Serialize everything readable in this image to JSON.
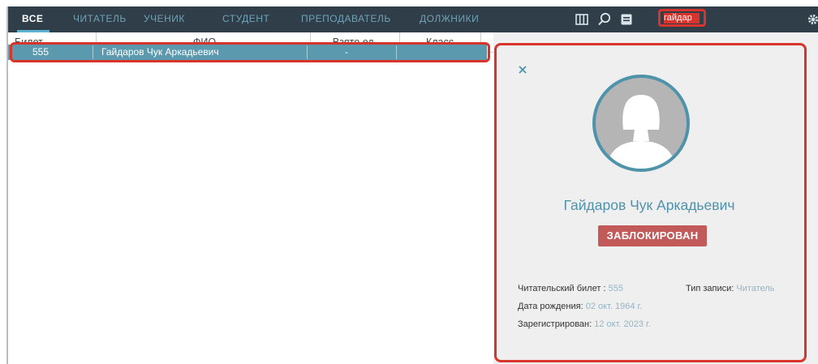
{
  "tabs": [
    {
      "label": "ВСЕ",
      "active": true
    },
    {
      "label": "ЧИТАТЕЛЬ",
      "active": false
    },
    {
      "label": "УЧЕНИК",
      "active": false
    },
    {
      "label": "СТУДЕНТ",
      "active": false
    },
    {
      "label": "ПРЕПОДАВАТЕЛЬ",
      "active": false
    },
    {
      "label": "ДОЛЖНИКИ",
      "active": false
    }
  ],
  "toolbar": {
    "icons": [
      "columns-icon",
      "search-icon",
      "filter-icon"
    ],
    "search_value": "гайдар",
    "settings_icon": "gear-icon"
  },
  "table": {
    "headers": [
      "Билет",
      "ФИО",
      "Взято ед.",
      "Класс"
    ],
    "rows": [
      {
        "ticket": "555",
        "name": "Гайдаров Чук Аркадьевич",
        "taken": "-",
        "class": ""
      }
    ]
  },
  "details": {
    "close_icon": "close-icon",
    "avatar_icon": "user-avatar-icon",
    "name": "Гайдаров Чук Аркадьевич",
    "status": "ЗАБЛОКИРОВАН",
    "ticket_label": "Читательский билет :",
    "ticket_value": "555",
    "type_label": "Тип записи:",
    "type_value": "Читатель",
    "birth_label": "Дата рождения:",
    "birth_value": "02 окт. 1964 г.",
    "reg_label": "Зарегистрирован:",
    "reg_value": "12 окт. 2023 г."
  },
  "colors": {
    "topbar": "#2f3e48",
    "tab_inactive": "#6fa3b7",
    "accent": "#5ab3d0",
    "highlight": "#d9342b",
    "row_selected": "#5b9aae",
    "name": "#4f93ab",
    "status_badge": "#c35a5a"
  }
}
